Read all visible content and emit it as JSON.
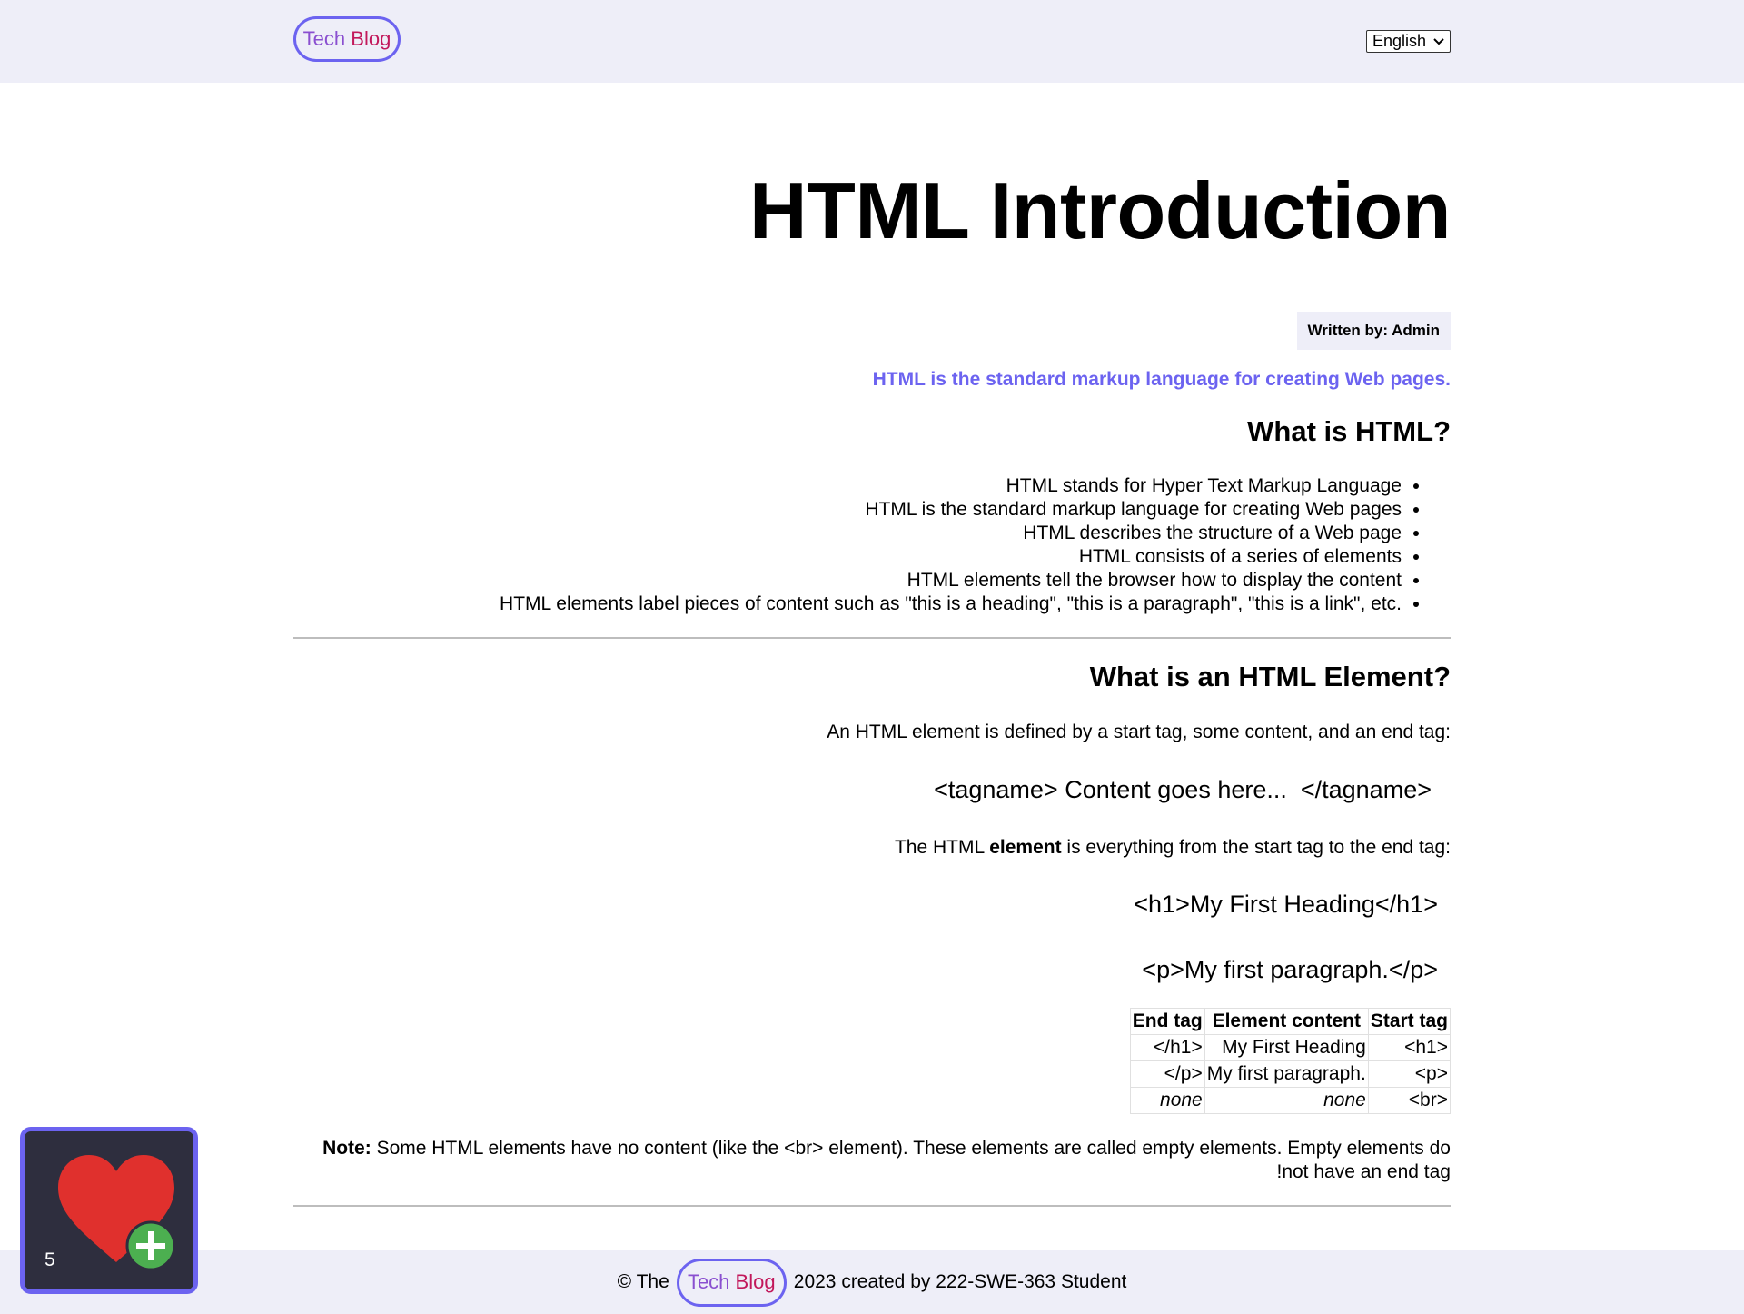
{
  "header": {
    "brand_part1": "Tech",
    "brand_part2": "Blog",
    "language": "English"
  },
  "article": {
    "title": "HTML Introduction",
    "author": "Written by: Admin",
    "lead": ".HTML is the standard markup language for creating Web pages",
    "section1_heading": "?What is HTML",
    "facts": [
      "HTML stands for Hyper Text Markup Language",
      "HTML is the standard markup language for creating Web pages",
      "HTML describes the structure of a Web page",
      "HTML consists of a series of elements",
      "HTML elements tell the browser how to display the content",
      ".HTML elements label pieces of content such as \"this is a heading\", \"this is a paragraph\", \"this is a link\", etc"
    ],
    "section2_heading": "?What is an HTML Element",
    "element_def": ":An HTML element is defined by a start tag, some content, and an end tag",
    "syntax_example": "<tagname> Content goes here...  </tagname>",
    "element_text_before": ":The HTML ",
    "element_text_bold": "element",
    "element_text_after": " is everything from the start tag to the end tag",
    "code_h1": "<h1>My First Heading</h1>",
    "code_p": "<p>My first paragraph.</p>",
    "table": {
      "headers": [
        "Start tag",
        "Element content",
        "End tag"
      ],
      "rows": [
        [
          "<h1>",
          "My First Heading",
          "<h1/>"
        ],
        [
          "<p>",
          ".My first paragraph",
          "<p/>"
        ],
        [
          "<br>",
          "none",
          "none"
        ]
      ]
    },
    "note_label": "Note:",
    "note_text": " Some HTML elements have no content (like the <br> element). These elements are called empty elements. Empty elements do not have an end tag!"
  },
  "footer": {
    "prefix": "© The",
    "brand_part1": "Tech",
    "brand_part2": "Blog",
    "suffix": "2023 created by 222-SWE-363 Student"
  },
  "favorites_widget": {
    "count": "5",
    "icon": "heart-plus-icon"
  }
}
